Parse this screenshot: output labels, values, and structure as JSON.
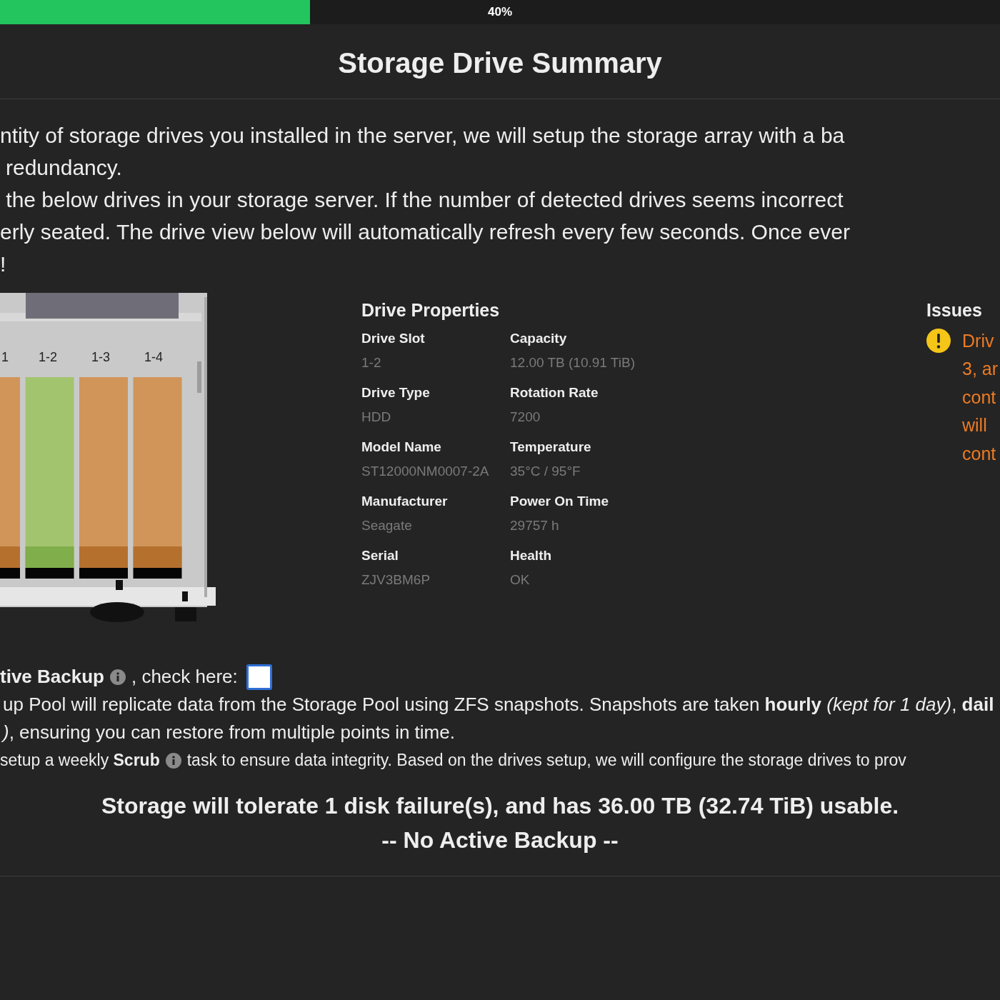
{
  "progress": {
    "level": 0.31,
    "label": "40%"
  },
  "title": "Storage Drive Summary",
  "intro": [
    [
      "ntity of storage drives you installed in the server, we will setup the storage array with a ba",
      "redundancy."
    ],
    [
      "the below drives in your storage server. If the number of detected drives seems incorrect",
      "erly seated. The drive view below will automatically refresh every few seconds. Once ever",
      "!"
    ]
  ],
  "drive_bay": {
    "slots": [
      {
        "label": "1",
        "selected": false
      },
      {
        "label": "1-2",
        "selected": true
      },
      {
        "label": "1-3",
        "selected": false
      },
      {
        "label": "1-4",
        "selected": false
      }
    ]
  },
  "drive_properties": {
    "heading": "Drive Properties",
    "fields": [
      {
        "label": "Drive Slot",
        "value": "1-2"
      },
      {
        "label": "Capacity",
        "value": "12.00 TB (10.91 TiB)"
      },
      {
        "label": "Drive Type",
        "value": "HDD"
      },
      {
        "label": "Rotation Rate",
        "value": "7200"
      },
      {
        "label": "Model Name",
        "value": "ST12000NM0007-2A"
      },
      {
        "label": "Temperature",
        "value": "35°C / 95°F"
      },
      {
        "label": "Manufacturer",
        "value": "Seagate"
      },
      {
        "label": "Power On Time",
        "value": "29757 h"
      },
      {
        "label": "Serial",
        "value": "ZJV3BM6P"
      },
      {
        "label": "Health",
        "value": "OK"
      }
    ]
  },
  "issues": {
    "heading": "Issues",
    "items": [
      {
        "kind": "warning",
        "lines": [
          "Driv",
          "3, ar",
          "cont",
          "will",
          "cont"
        ]
      }
    ]
  },
  "backup": {
    "label": "tive Backup",
    "suffix": ", check here:",
    "checked": false,
    "description": [
      "up Pool will replicate data from the Storage Pool using ZFS snapshots. Snapshots are taken **hourly** *(kept for 1 day)*, **dail**",
      "*)*, ensuring you can restore from multiple points in time."
    ]
  },
  "scrub": {
    "before": "setup a weekly **Scrub**",
    "after": "task to ensure data integrity. Based on the drives setup, we will configure the storage drives to prov"
  },
  "summary": [
    "Storage will tolerate 1 disk failure(s), and has 36.00 TB (32.74 TiB) usable.",
    "-- No Active Backup --"
  ]
}
